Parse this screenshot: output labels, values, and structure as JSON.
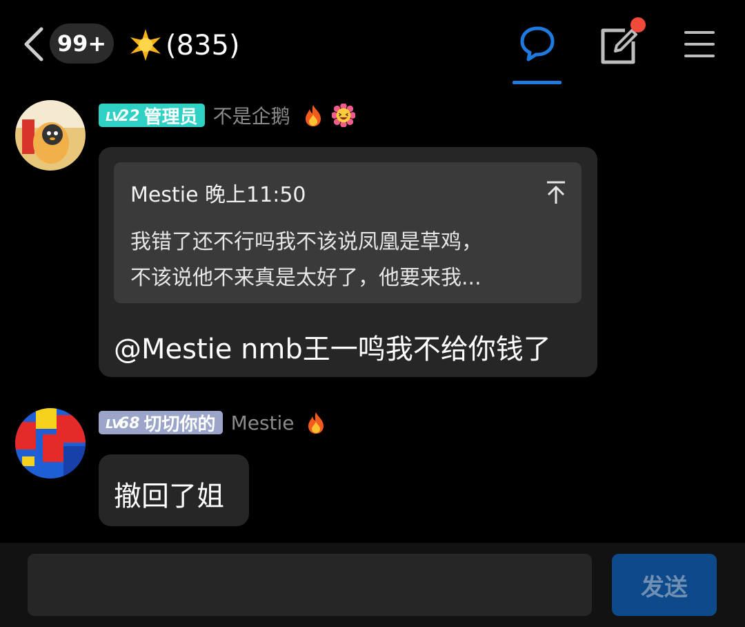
{
  "header": {
    "unread_badge": "99+",
    "group_count": "(835)",
    "accent_color": "#1f7ae0",
    "icons": [
      "back-arrow-icon",
      "star-icon",
      "chat-bubble-icon",
      "edit-icon",
      "menu-icon"
    ]
  },
  "messages": [
    {
      "level_prefix": "LV",
      "level": "22",
      "role": "管理员",
      "role_color": "#2ed1c4",
      "sender": "不是企鹅",
      "emojis": [
        "fire-icon",
        "laughing-face-icon"
      ],
      "quote": {
        "author_time": "Mestie 晚上11:50",
        "lines": [
          "我错了还不行吗我不该说凤凰是草鸡，",
          "不该说他不来真是太好了，他要来我..."
        ]
      },
      "text": "@Mestie  nmb王一鸣我不给你钱了"
    },
    {
      "level_prefix": "LV",
      "level": "68",
      "role": "切切你的",
      "role_color": "#9aa5c9",
      "sender": "Mestie",
      "emojis": [
        "fire-icon"
      ],
      "text": "撤回了姐"
    }
  ],
  "composer": {
    "placeholder": "",
    "send_label": "发送"
  }
}
